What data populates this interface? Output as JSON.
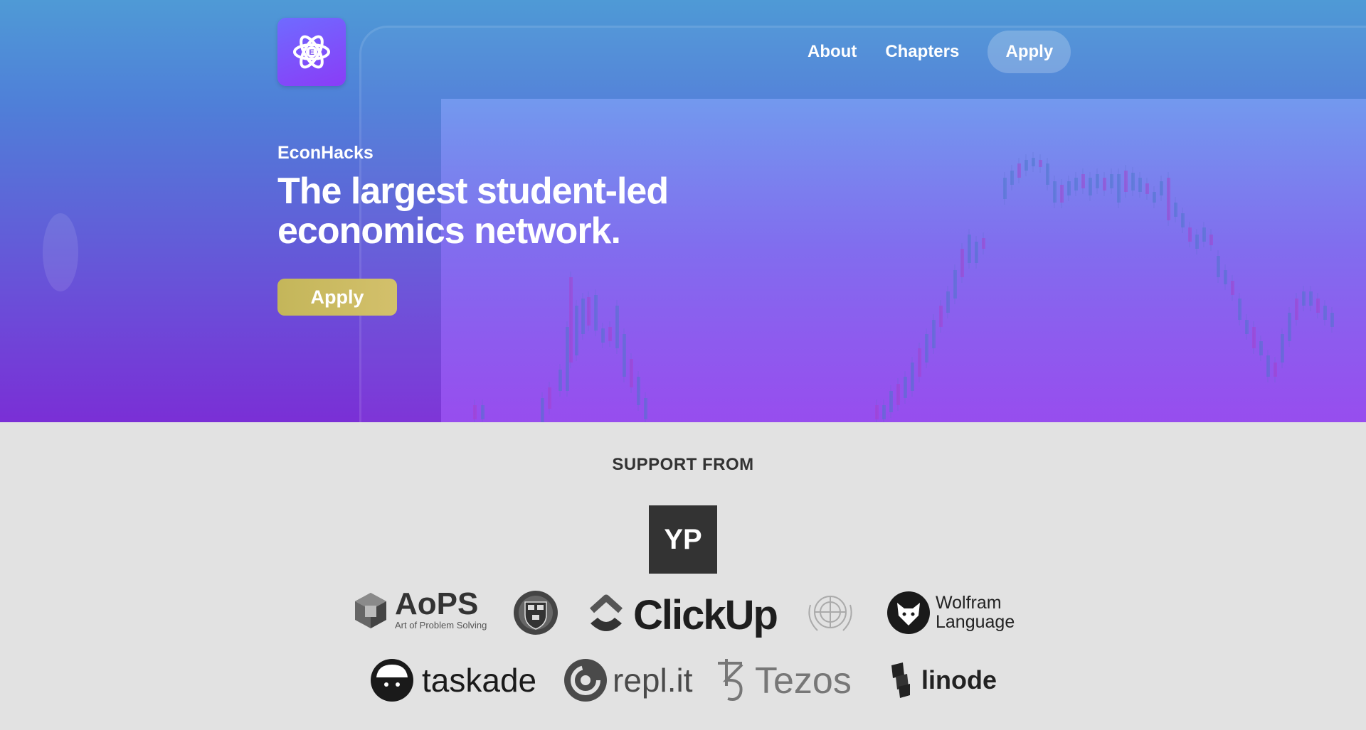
{
  "nav": {
    "about_label": "About",
    "chapters_label": "Chapters",
    "apply_label": "Apply"
  },
  "hero": {
    "brand": "EconHacks",
    "headline_line1": "The largest student-led",
    "headline_line2": "economics network.",
    "cta_label": "Apply"
  },
  "support": {
    "title": "SUPPORT FROM",
    "yp_label": "YP",
    "aops_name": "AoPS",
    "aops_tagline": "Art of Problem Solving",
    "clickup_name": "ClickUp",
    "wolfram_line1": "Wolfram",
    "wolfram_line2": "Language",
    "taskade_name": "taskade",
    "replit_name": "repl.it",
    "tezos_name": "Tezos",
    "linode_name": "linode"
  },
  "colors": {
    "hero_top": "#4f9ad6",
    "hero_bottom": "#7a2fd6",
    "cta": "#c9b962",
    "page_bg": "#e2e2e2"
  },
  "icons": [
    "atom-logo-icon",
    "harvard-shield-icon",
    "un-emblem-icon",
    "wolfram-wolf-icon"
  ]
}
